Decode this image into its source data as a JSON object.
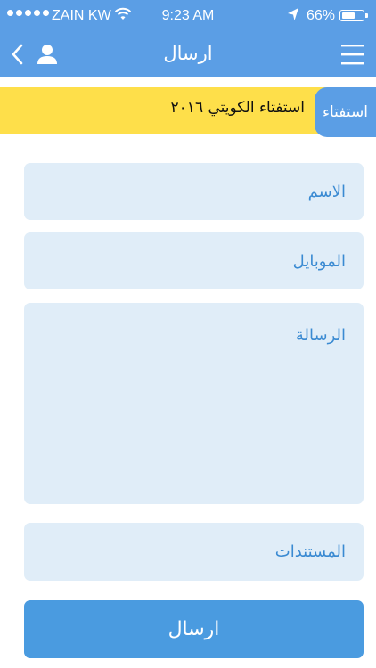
{
  "status_bar": {
    "carrier": "ZAIN KW",
    "time": "9:23 AM",
    "battery_percent": "66%",
    "battery_level": 0.66,
    "icons": [
      "signal-dots-icon",
      "wifi-icon",
      "location-arrow-icon",
      "battery-icon"
    ]
  },
  "nav": {
    "title": "ارسال",
    "icons": [
      "back-chevron-icon",
      "profile-icon",
      "hamburger-menu-icon"
    ]
  },
  "poll": {
    "tab_label": "استفتاء",
    "banner_text": "استفتاء الكويتي ٢٠١٦"
  },
  "form": {
    "name_placeholder": "الاسم",
    "mobile_placeholder": "الموبايل",
    "message_placeholder": "الرسالة",
    "documents_placeholder": "المستندات",
    "submit_label": "ارسال"
  },
  "colors": {
    "primary": "#5b9ee5",
    "banner": "#fedf4a",
    "field_bg": "#e0edf8",
    "field_text": "#3a8ad2",
    "button": "#4a9be0"
  }
}
